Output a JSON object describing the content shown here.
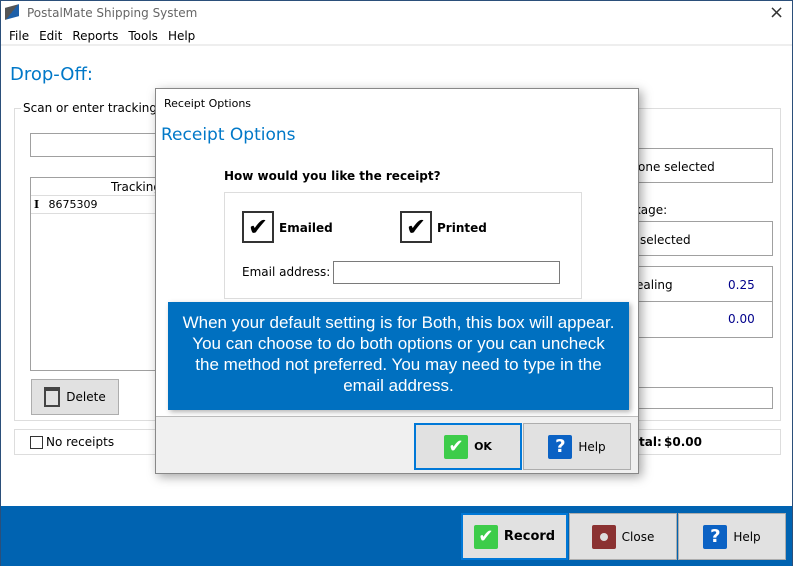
{
  "window": {
    "title": "PostalMate Shipping System",
    "close_icon": "×"
  },
  "menu": [
    "File",
    "Edit",
    "Reports",
    "Tools",
    "Help"
  ],
  "main": {
    "title": "Drop-Off:",
    "group_label": "Scan or enter tracking",
    "tracking_input": "",
    "table": {
      "header": "Tracking",
      "rows": [
        {
          "marker": "I",
          "tracking": "8675309"
        }
      ]
    },
    "delete_label": "Delete",
    "no_receipts_label": "No receipts",
    "right": {
      "box1": "one selected",
      "label2": "kage:",
      "box2": "selected",
      "fees": [
        {
          "label": "ealing",
          "value": "0.25"
        },
        {
          "label": "",
          "value": "0.00"
        }
      ],
      "total_label": "tal:",
      "total_value": "$0.00"
    }
  },
  "dialog": {
    "title": "Receipt Options",
    "heading": "Receipt Options",
    "question": "How would you like the receipt?",
    "emailed_label": "Emailed",
    "emailed_checked": true,
    "printed_label": "Printed",
    "printed_checked": true,
    "email_label": "Email address:",
    "email_value": "",
    "callout": "When your default setting is for Both, this box will appear. You can choose to do both options or you can uncheck the method not preferred. You may need to type in the email address.",
    "ok_label": "OK",
    "help_label": "Help"
  },
  "footer": {
    "record_label": "Record",
    "close_label": "Close",
    "help_label": "Help"
  },
  "colors": {
    "accent": "#0078c8",
    "footer": "#0063b1",
    "callout": "#0070c0",
    "ok_green": "#3dcc4a",
    "close_red": "#8b3232"
  }
}
